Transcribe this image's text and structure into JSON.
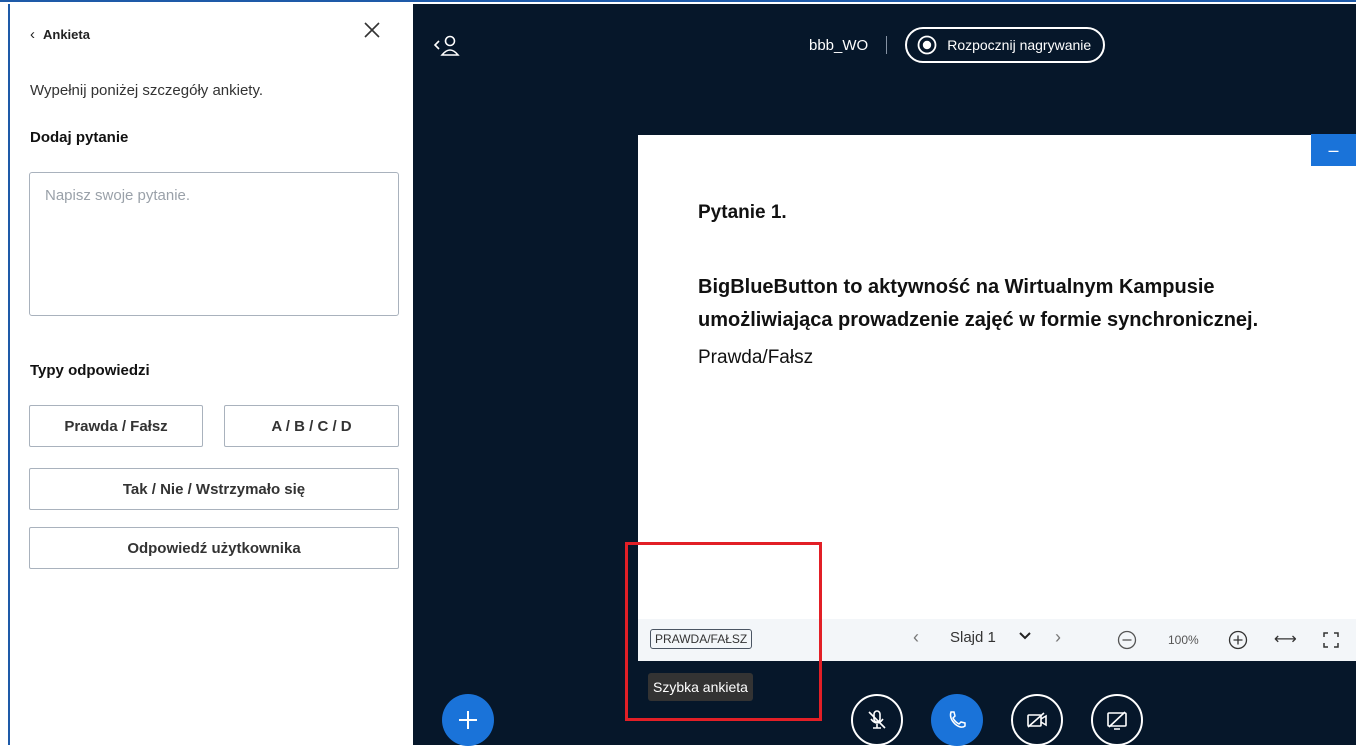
{
  "poll_panel": {
    "back_label": "Ankieta",
    "instructions": "Wypełnij poniżej szczegóły ankiety.",
    "question_heading": "Dodaj pytanie",
    "question_placeholder": "Napisz swoje pytanie.",
    "answer_types_heading": "Typy odpowiedzi",
    "answer_types": {
      "true_false": "Prawda / Fałsz",
      "abcd": "A / B / C / D",
      "yes_no_abstain": "Tak / Nie / Wstrzymało się",
      "user_response": "Odpowiedź użytkownika"
    }
  },
  "header": {
    "meeting_name": "bbb_WO",
    "record_label": "Rozpocznij nagrywanie"
  },
  "slide": {
    "question_title": "Pytanie 1.",
    "line1": "BigBlueButton to aktywność na Wirtualnym Kampusie",
    "line2": "umożliwiająca prowadzenie zajęć w formie synchronicznej.",
    "answer_hint": "Prawda/Fałsz",
    "minimize_label": "–"
  },
  "slide_toolbar": {
    "quick_poll_label": "PRAWDA/FAŁSZ",
    "slide_label": "Slajd 1",
    "zoom_level": "100%"
  },
  "tooltip": {
    "text": "Szybka ankieta"
  },
  "colors": {
    "main_bg": "#06172a",
    "accent_blue": "#1a73d9",
    "highlight_red": "#e21f26"
  }
}
